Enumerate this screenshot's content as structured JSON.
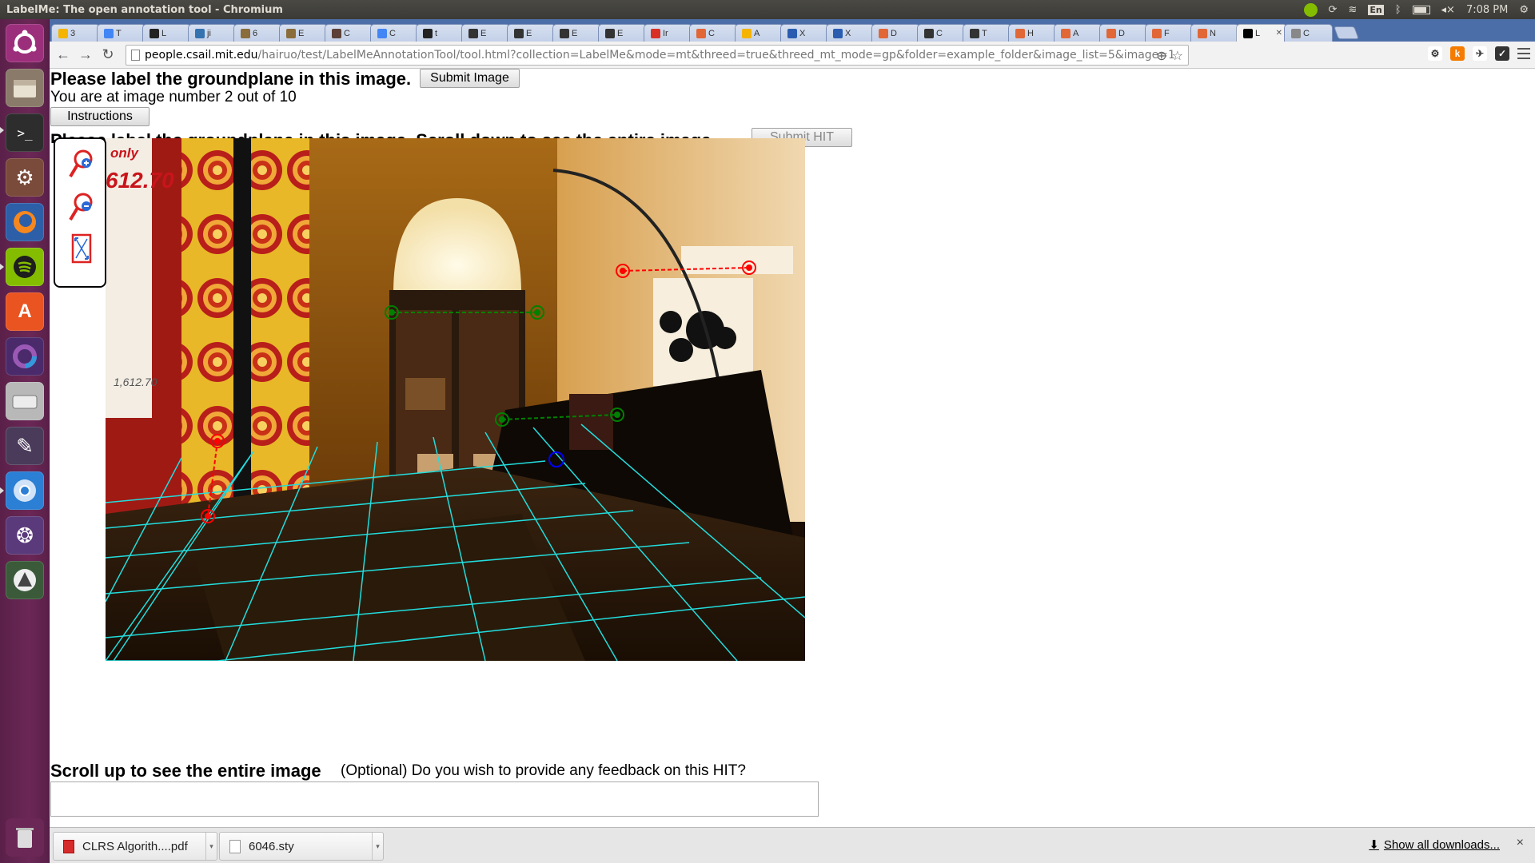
{
  "window": {
    "title": "LabelMe: The open annotation tool - Chromium"
  },
  "tray": {
    "clock": "7:08 PM",
    "keyboard_layout": "En"
  },
  "tabs": [
    {
      "label": "3",
      "icon": "drive-icon",
      "color": "#f4b400"
    },
    {
      "label": "T",
      "icon": "doc-icon",
      "color": "#4285f4"
    },
    {
      "label": "L",
      "icon": "github-icon",
      "color": "#222222"
    },
    {
      "label": "ji",
      "icon": "jira-icon",
      "color": "#3572b0"
    },
    {
      "label": "6",
      "icon": "bookmark-icon",
      "color": "#8a6d3b"
    },
    {
      "label": "E",
      "icon": "bookmark-icon",
      "color": "#8a6d3b"
    },
    {
      "label": "C",
      "icon": "cocoa-icon",
      "color": "#5d4037"
    },
    {
      "label": "C",
      "icon": "doc-icon",
      "color": "#4285f4"
    },
    {
      "label": "t",
      "icon": "github-icon",
      "color": "#222222"
    },
    {
      "label": "E",
      "icon": "wiki-icon",
      "color": "#333333"
    },
    {
      "label": "E",
      "icon": "wiki-icon",
      "color": "#333333"
    },
    {
      "label": "E",
      "icon": "wiki-icon",
      "color": "#333333"
    },
    {
      "label": "E",
      "icon": "wiki-icon",
      "color": "#333333"
    },
    {
      "label": "Ir",
      "icon": "gmail-icon",
      "color": "#d93025"
    },
    {
      "label": "C",
      "icon": "matlab-icon",
      "color": "#e16737"
    },
    {
      "label": "A",
      "icon": "circle-icon",
      "color": "#f4b400"
    },
    {
      "label": "X",
      "icon": "w3-icon",
      "color": "#2a5db0"
    },
    {
      "label": "X",
      "icon": "w3-icon",
      "color": "#2a5db0"
    },
    {
      "label": "D",
      "icon": "matlab-icon",
      "color": "#e16737"
    },
    {
      "label": "C",
      "icon": "wiki-icon",
      "color": "#333333"
    },
    {
      "label": "T",
      "icon": "wiki-icon",
      "color": "#333333"
    },
    {
      "label": "H",
      "icon": "matlab-icon",
      "color": "#e16737"
    },
    {
      "label": "A",
      "icon": "matlab-icon",
      "color": "#e16737"
    },
    {
      "label": "D",
      "icon": "matlab-icon",
      "color": "#e16737"
    },
    {
      "label": "F",
      "icon": "matlab-icon",
      "color": "#e16737"
    },
    {
      "label": "N",
      "icon": "matlab-icon",
      "color": "#e16737"
    },
    {
      "label": "L",
      "icon": "labelme-icon",
      "color": "#000000",
      "active": true
    },
    {
      "label": "C",
      "icon": "page-icon",
      "color": "#888888"
    }
  ],
  "toolbar": {
    "url_host": "people.csail.mit.edu",
    "url_path": "/hairuo/test/LabelMeAnnotationTool/tool.html?collection=LabelMe&mode=mt&threed=true&threed_mt_mode=gp&folder=example_folder&image_list=5&image=1"
  },
  "page": {
    "title": "Please label the groundplane in this image.",
    "submit_image_label": "Submit Image",
    "counter_text": "You are at image number 2 out of 10",
    "instructions_label": "Instructions",
    "second_title": "Please label the groundplane in this image. Scroll down to see the entire image.",
    "submit_hit_label": "Submit HIT",
    "footer_title": "Scroll up to see the entire image",
    "feedback_question": "(Optional) Do you wish to provide any feedback on this HIT?",
    "feedback_value": ""
  },
  "tools": [
    {
      "name": "zoom-in-icon"
    },
    {
      "name": "zoom-out-icon"
    },
    {
      "name": "fit-to-screen-icon"
    }
  ],
  "annotation_colors": {
    "vertical_lines": "#ff0000",
    "horizontal_lines": "#008000",
    "origin": "#0000ff",
    "grid": "#22dddd"
  },
  "image_text": {
    "price_top": "only",
    "price_main": "612.70",
    "price_small": "1,612.70"
  },
  "downloads": [
    {
      "name": "CLRS Algorith....pdf",
      "type": "pdf"
    },
    {
      "name": "6046.sty",
      "type": "file"
    }
  ],
  "download_shelf": {
    "show_all_label": "Show all downloads..."
  }
}
